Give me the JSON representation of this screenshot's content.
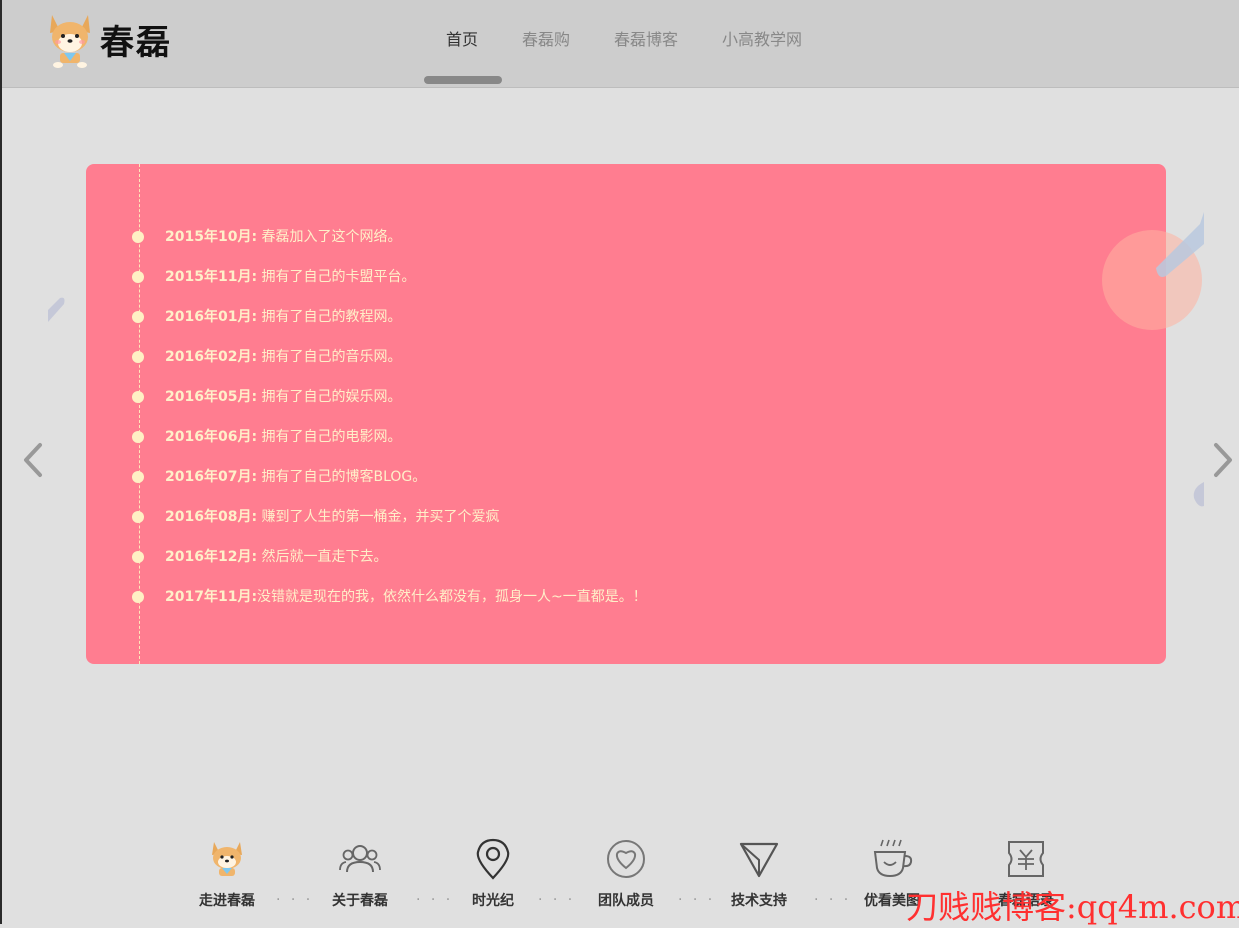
{
  "header": {
    "logo_text": "春磊",
    "nav": [
      "首页",
      "春磊购",
      "春磊博客",
      "小高教学网"
    ]
  },
  "timeline": [
    {
      "date": "2015年10月:",
      "text": " 春磊加入了这个网络。"
    },
    {
      "date": "2015年11月:",
      "text": " 拥有了自己的卡盟平台。"
    },
    {
      "date": "2016年01月:",
      "text": " 拥有了自己的教程网。"
    },
    {
      "date": "2016年02月:",
      "text": " 拥有了自己的音乐网。"
    },
    {
      "date": "2016年05月:",
      "text": " 拥有了自己的娱乐网。"
    },
    {
      "date": "2016年06月:",
      "text": " 拥有了自己的电影网。"
    },
    {
      "date": "2016年07月:",
      "text": " 拥有了自己的博客BLOG。"
    },
    {
      "date": "2016年08月:",
      "text": " 赚到了人生的第一桶金，并买了个爱疯"
    },
    {
      "date": "2016年12月:",
      "text": " 然后就一直走下去。"
    },
    {
      "date": "2017年11月:",
      "text": "没错就是现在的我，依然什么都没有，孤身一人~一直都是。！"
    }
  ],
  "bottom_nav": [
    {
      "label": "走进春磊",
      "icon": "shiba-icon"
    },
    {
      "label": "关于春磊",
      "icon": "users-icon"
    },
    {
      "label": "时光纪",
      "icon": "location-icon"
    },
    {
      "label": "团队成员",
      "icon": "heart-icon"
    },
    {
      "label": "技术支持",
      "icon": "send-icon"
    },
    {
      "label": "优看美图",
      "icon": "coffee-icon"
    },
    {
      "label": "春磊语录",
      "icon": "ticket-icon"
    }
  ],
  "dots": "· · ·",
  "watermark": "刀贱贱博客:qq4m.com",
  "colors": {
    "card": "#ff7d90",
    "timeline_text": "#ffefc9",
    "header": "#cdcdcd",
    "page": "#e0e0e0"
  }
}
